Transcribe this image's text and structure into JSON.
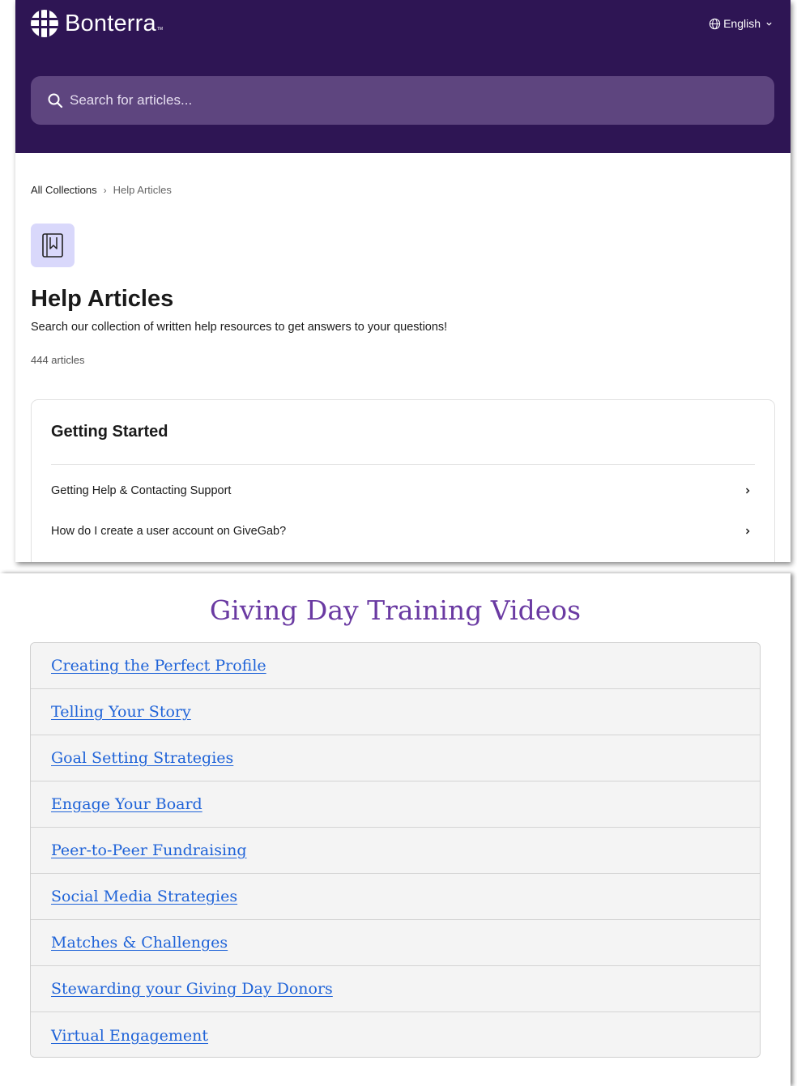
{
  "header": {
    "brand": "Bonterra",
    "brand_mark": "TM",
    "language": "English"
  },
  "search": {
    "placeholder": "Search for articles..."
  },
  "breadcrumb": {
    "root": "All Collections",
    "separator": "›",
    "current": "Help Articles"
  },
  "collection": {
    "icon": "bookmark-book-icon",
    "title": "Help Articles",
    "description": "Search our collection of written help resources to get answers to your questions!",
    "count": "444 articles"
  },
  "section": {
    "title": "Getting Started",
    "articles": [
      "Getting Help & Contacting Support",
      "How do I create a user account on GiveGab?"
    ]
  },
  "videos": {
    "title": "Giving Day Training Videos",
    "links": [
      "Creating the Perfect Profile",
      "Telling Your Story",
      "Goal Setting Strategies",
      "Engage Your Board",
      "Peer-to-Peer Fundraising",
      "Social Media Strategies",
      "Matches & Challenges",
      "Stewarding your Giving Day Donors",
      "Virtual Engagement"
    ]
  },
  "colors": {
    "hero_bg": "#2e1554",
    "search_bg": "#5e457f",
    "icon_tile": "#d9d8fb",
    "video_title": "#6a3aa2",
    "link": "#1f63d8"
  }
}
